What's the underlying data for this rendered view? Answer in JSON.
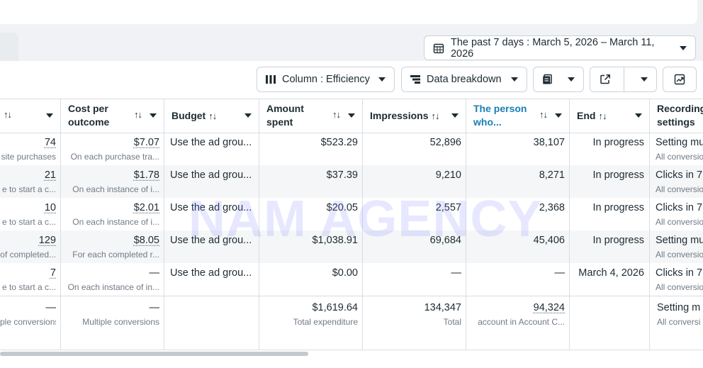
{
  "date_range": {
    "label": "The past 7 days : March 5, 2026 – March 11, 2026"
  },
  "toolbar": {
    "column_label": "Column : Efficiency",
    "breakdown_label": "Data breakdown"
  },
  "watermark": "NAM AGENCY",
  "columns": {
    "results": "",
    "cost_per_outcome": {
      "line1": "Cost per",
      "line2": "outcome"
    },
    "budget": "Budget",
    "amount_spent": {
      "line1": "Amount",
      "line2": "spent"
    },
    "impressions": "Impressions",
    "reach": {
      "line1": "The person",
      "line2": "who..."
    },
    "end": "End",
    "recording": {
      "line1": "Recording",
      "line2": "settings"
    }
  },
  "rows": [
    {
      "results": "74",
      "results_sub": "site purchases",
      "cost": "$7.07",
      "cost_sub": "On each purchase tra...",
      "budget": "Use the ad grou...",
      "spent": "$523.29",
      "impressions": "52,896",
      "reach": "38,107",
      "end": "In progress",
      "rec": "Setting mu",
      "rec_sub": "All conversio"
    },
    {
      "results": "21",
      "results_sub": "e to start a c...",
      "cost": "$1.78",
      "cost_sub": "On each instance of i...",
      "budget": "Use the ad grou...",
      "spent": "$37.39",
      "impressions": "9,210",
      "reach": "8,271",
      "end": "In progress",
      "rec": "Clicks in 7",
      "rec_sub": "All conversio"
    },
    {
      "results": "10",
      "results_sub": "e to start a c...",
      "cost": "$2.01",
      "cost_sub": "On each instance of i...",
      "budget": "Use the ad grou...",
      "spent": "$20.05",
      "impressions": "2,557",
      "reach": "2,368",
      "end": "In progress",
      "rec": "Clicks in 7",
      "rec_sub": "All conversio"
    },
    {
      "results": "129",
      "results_sub": "of completed...",
      "cost": "$8.05",
      "cost_sub": "For each completed r...",
      "budget": "Use the ad grou...",
      "spent": "$1,038.91",
      "impressions": "69,684",
      "reach": "45,406",
      "end": "In progress",
      "rec": "Setting mu",
      "rec_sub": "All conversio"
    },
    {
      "results": "7",
      "results_sub": "e to start a c...",
      "cost": "—",
      "cost_sub": "On each instance of in...",
      "budget": "Use the ad grou...",
      "spent": "$0.00",
      "impressions": "—",
      "reach": "—",
      "end": "March 4, 2026",
      "rec": "Clicks in 7",
      "rec_sub": "All conversio"
    }
  ],
  "totals": {
    "results": "—",
    "results_sub": "ple conversions",
    "cost": "—",
    "cost_sub": "Multiple conversions",
    "spent": "$1,619.64",
    "spent_sub": "Total expenditure",
    "impressions": "134,347",
    "impressions_sub": "Total",
    "reach": "94,324",
    "reach_sub": "account in Account C...",
    "rec": "Setting m",
    "rec_sub": "All conversi"
  }
}
